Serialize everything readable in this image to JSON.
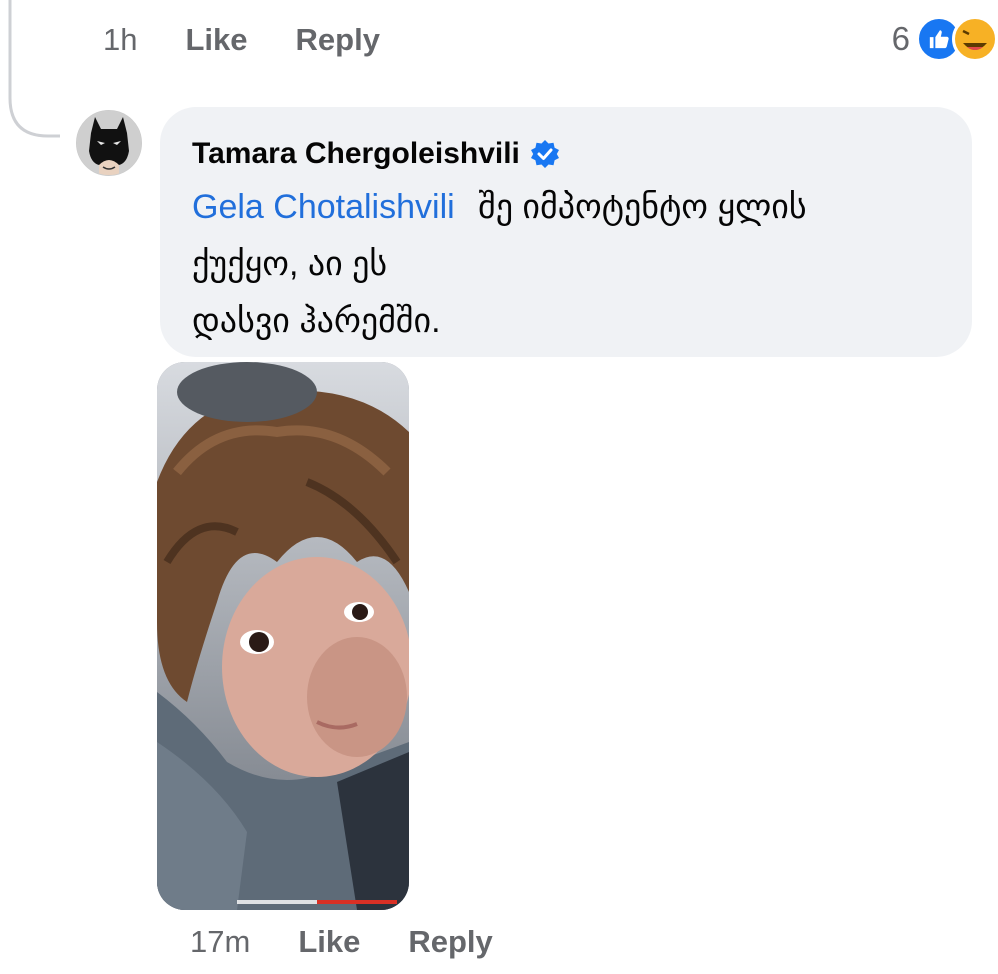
{
  "parent_comment": {
    "time": "1h",
    "like_label": "Like",
    "reply_label": "Reply",
    "reaction_count": "6",
    "reaction_icons": [
      "like-icon",
      "haha-icon"
    ]
  },
  "reply": {
    "author": "Tamara Chergoleishvili",
    "verified_icon": "verified-badge-icon",
    "mention": "Gela Chotalishvili",
    "text_line1": "შე იმპოტენტო ყლის",
    "text_line2": "ქუქყო, აი ეს",
    "text_line3": "დასვი ჰარემში.",
    "time": "17m",
    "like_label": "Like",
    "reply_label": "Reply"
  },
  "colors": {
    "bubble": "#f0f2f5",
    "mention": "#216fdb",
    "meta": "#65676b",
    "like_blue": "#1877f2",
    "haha_yellow": "#f7b125"
  }
}
